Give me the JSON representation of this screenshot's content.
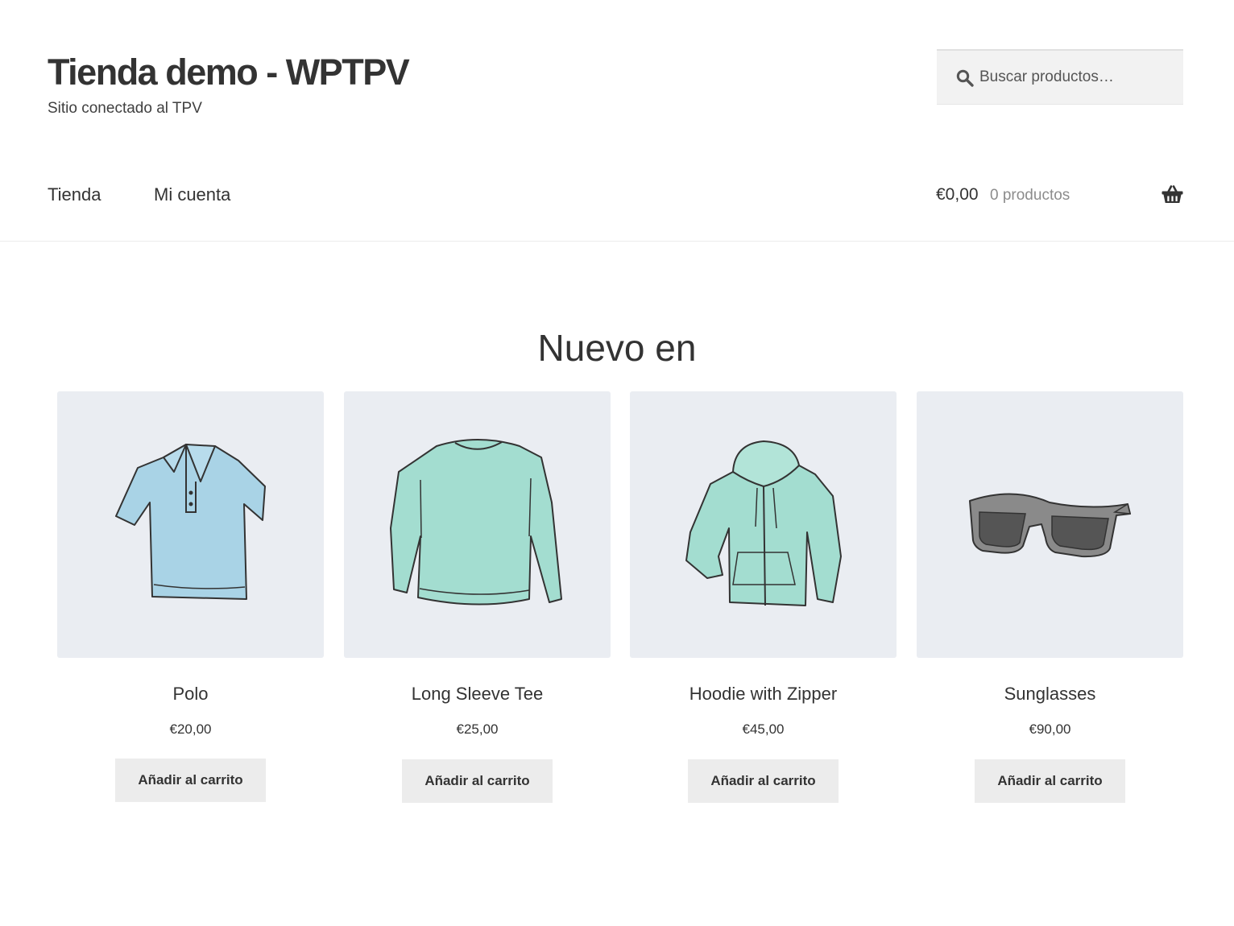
{
  "header": {
    "site_title": "Tienda demo - WPTPV",
    "tagline": "Sitio conectado al TPV",
    "search": {
      "placeholder": "Buscar productos…",
      "value": "",
      "icon": "search-icon"
    }
  },
  "nav": {
    "items": [
      {
        "label": "Tienda"
      },
      {
        "label": "Mi cuenta"
      }
    ]
  },
  "cart": {
    "amount": "€0,00",
    "count_label": "0 productos",
    "icon": "basket-icon"
  },
  "main": {
    "section_title": "Nuevo en",
    "products": [
      {
        "name": "Polo",
        "price": "€20,00",
        "button_label": "Añadir al carrito",
        "image": "polo-shirt"
      },
      {
        "name": "Long Sleeve Tee",
        "price": "€25,00",
        "button_label": "Añadir al carrito",
        "image": "long-sleeve-tee"
      },
      {
        "name": "Hoodie with Zipper",
        "price": "€45,00",
        "button_label": "Añadir al carrito",
        "image": "zip-hoodie"
      },
      {
        "name": "Sunglasses",
        "price": "€90,00",
        "button_label": "Añadir al carrito",
        "image": "sunglasses"
      }
    ]
  },
  "colors": {
    "text": "#333333",
    "muted": "#8c8c8c",
    "image_background": "#eaedf2",
    "button_background": "#ececec",
    "polo": "#a9d3e6",
    "teal_garment": "#a3ddd0",
    "sunglasses_frame": "#8a8a8a",
    "sunglasses_lens": "#555555"
  }
}
